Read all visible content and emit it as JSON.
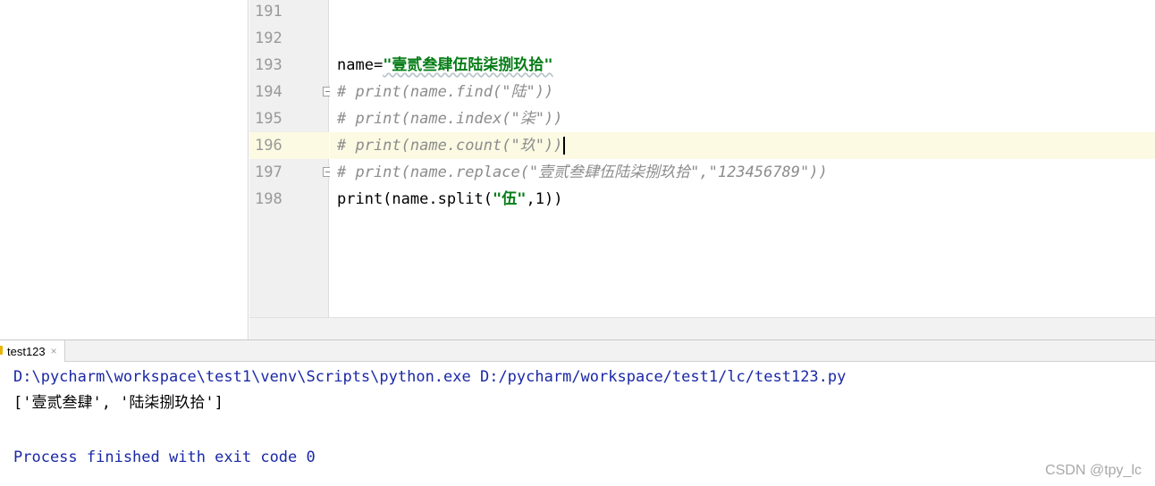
{
  "editor": {
    "lines": [
      {
        "number": "191",
        "code": ""
      },
      {
        "number": "192",
        "code": ""
      },
      {
        "number": "193",
        "code_prefix": "name=",
        "code_string": "\"壹贰叁肆伍陆柒捌玖拾\""
      },
      {
        "number": "194",
        "code": "# print(name.find(\"陆\"))"
      },
      {
        "number": "195",
        "code": "# print(name.index(\"柒\"))"
      },
      {
        "number": "196",
        "code": "# print(name.count(\"玖\"))"
      },
      {
        "number": "197",
        "code": "# print(name.replace(\"壹贰叁肆伍陆柒捌玖拾\",\"123456789\"))"
      },
      {
        "number": "198",
        "code_prefix": "print(name.split(",
        "code_string": "\"伍\"",
        "code_suffix": ",1))"
      }
    ],
    "current_line": "196"
  },
  "run_panel": {
    "tab_label": "test123",
    "close_glyph": "×",
    "console": {
      "command": "D:\\pycharm\\workspace\\test1\\venv\\Scripts\\python.exe D:/pycharm/workspace/test1/lc/test123.py",
      "output": "['壹贰叁肆', '陆柒捌玖拾']",
      "exit_message": "Process finished with exit code 0"
    }
  },
  "watermark": "CSDN @tpy_lc",
  "colors": {
    "string": "#067d17",
    "comment": "#8c8c8c",
    "console_blue": "#1a28a6",
    "current_line": "#fcfae3",
    "gutter": "#f0f0f0"
  },
  "icons": [
    "fold-marker-icon",
    "python-file-icon",
    "close-icon"
  ]
}
